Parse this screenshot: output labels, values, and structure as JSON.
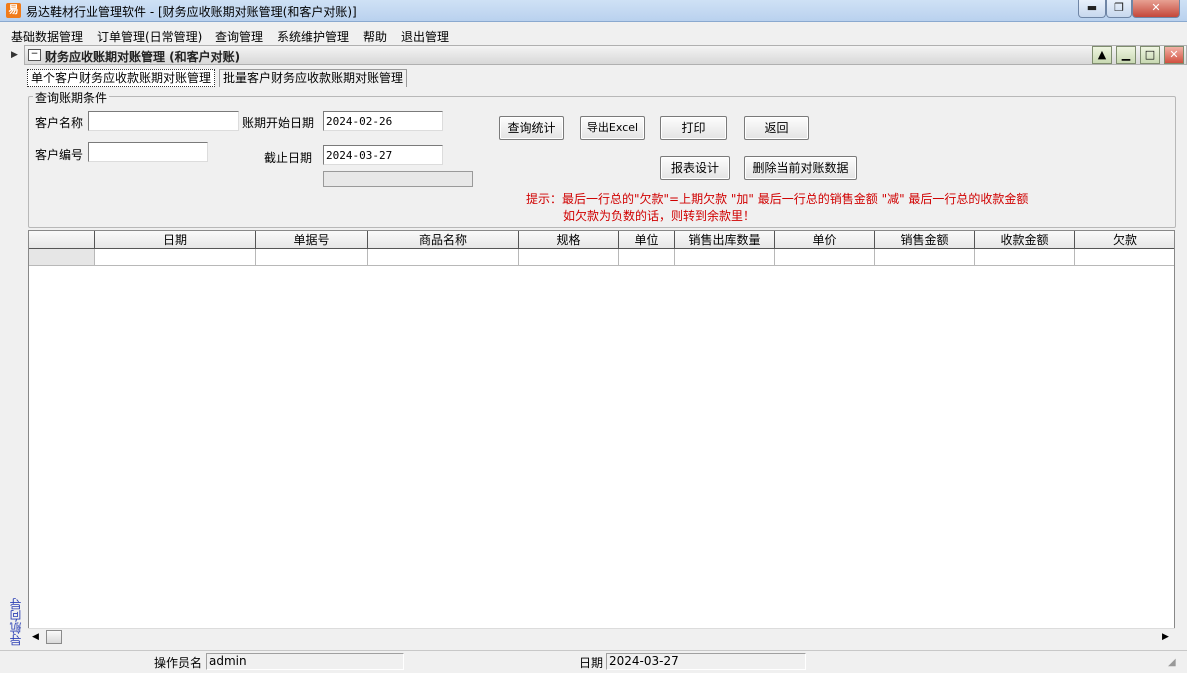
{
  "window": {
    "app_icon": "易",
    "title": "易达鞋材行业管理软件  - [财务应收账期对账管理(和客户对账)]",
    "min_icon": "▬",
    "max_icon": "❐",
    "close_icon": "✕"
  },
  "menu": [
    "基础数据管理",
    "订单管理(日常管理)",
    "查询管理",
    "系统维护管理",
    "帮助",
    "退出管理"
  ],
  "child": {
    "title": "财务应收账期对账管理 (和客户对账)",
    "buttons": [
      "▲",
      "▁",
      "□",
      "✕"
    ]
  },
  "tabs": [
    "单个客户财务应收款账期对账管理",
    "批量客户财务应收款账期对账管理"
  ],
  "query": {
    "legend": "查询账期条件",
    "customer_name_label": "客户名称",
    "customer_name_value": "",
    "customer_code_label": "客户编号",
    "customer_code_value": "",
    "start_date_label": "账期开始日期",
    "start_date_value": "2024-02-26",
    "end_date_label": "截止日期",
    "end_date_value": "2024-03-27"
  },
  "buttons": {
    "query_stats": "查询统计",
    "export_excel": "导出Excel",
    "print": "打印",
    "back": "返回",
    "report_design": "报表设计",
    "delete_current": "删除当前对账数据"
  },
  "hint": {
    "line1": "提示：最后一行总的\"欠款\"=上期欠款 \"加\" 最后一行总的销售金额 \"减\" 最后一行总的收款金额",
    "line2": "如欠款为负数的话，则转到余款里！"
  },
  "grid": {
    "columns": [
      "日期",
      "单据号",
      "商品名称",
      "规格",
      "单位",
      "销售出库数量",
      "单价",
      "销售金额",
      "收款金额",
      "欠款"
    ]
  },
  "nav_guide": "导航向导",
  "status": {
    "operator_label": "操作员名",
    "operator_value": "admin",
    "date_label": "日期",
    "date_value": "2024-03-27"
  },
  "colors": {
    "hint": "#d00000",
    "nav_guide": "#2b3fb5",
    "titlebar": "#b9d1ee"
  }
}
